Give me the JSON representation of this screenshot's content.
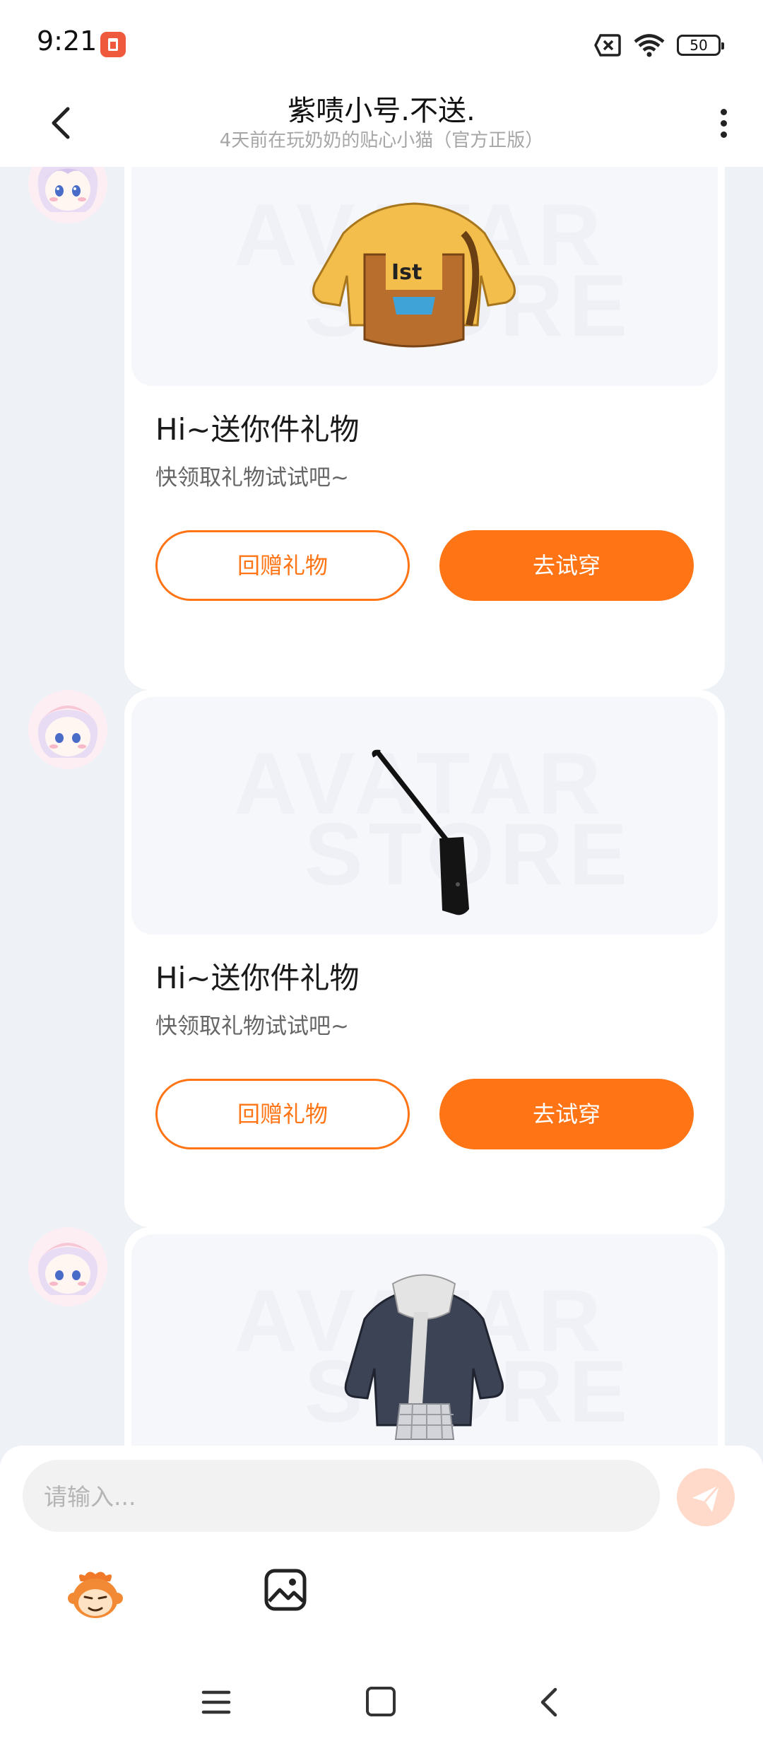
{
  "status_bar": {
    "time": "9:21",
    "battery": "50",
    "icons": [
      "app-notification-icon",
      "sim-disabled-icon",
      "wifi-icon",
      "battery-icon"
    ]
  },
  "header": {
    "title": "紫啧小号.不送.",
    "subtitle": "4天前在玩奶奶的贴心小猫（官方正版）",
    "back_icon": "chevron-left-icon",
    "more_icon": "more-vertical-icon"
  },
  "watermark": {
    "line1": "AVATAR",
    "line2": "STORE"
  },
  "messages": [
    {
      "item": "yellow-hoodie",
      "title": "Hi~送你件礼物",
      "subtitle": "快领取礼物试试吧~",
      "return_label": "回赠礼物",
      "try_label": "去试穿"
    },
    {
      "item": "black-crossbody-bag",
      "title": "Hi~送你件礼物",
      "subtitle": "快领取礼物试试吧~",
      "return_label": "回赠礼物",
      "try_label": "去试穿"
    },
    {
      "item": "navy-jacket-with-scarf"
    }
  ],
  "input": {
    "placeholder": "请输入..."
  },
  "colors": {
    "accent": "#ff7516",
    "background": "#eef2f7",
    "card": "#ffffff",
    "send_disabled": "#ffd9ca"
  }
}
